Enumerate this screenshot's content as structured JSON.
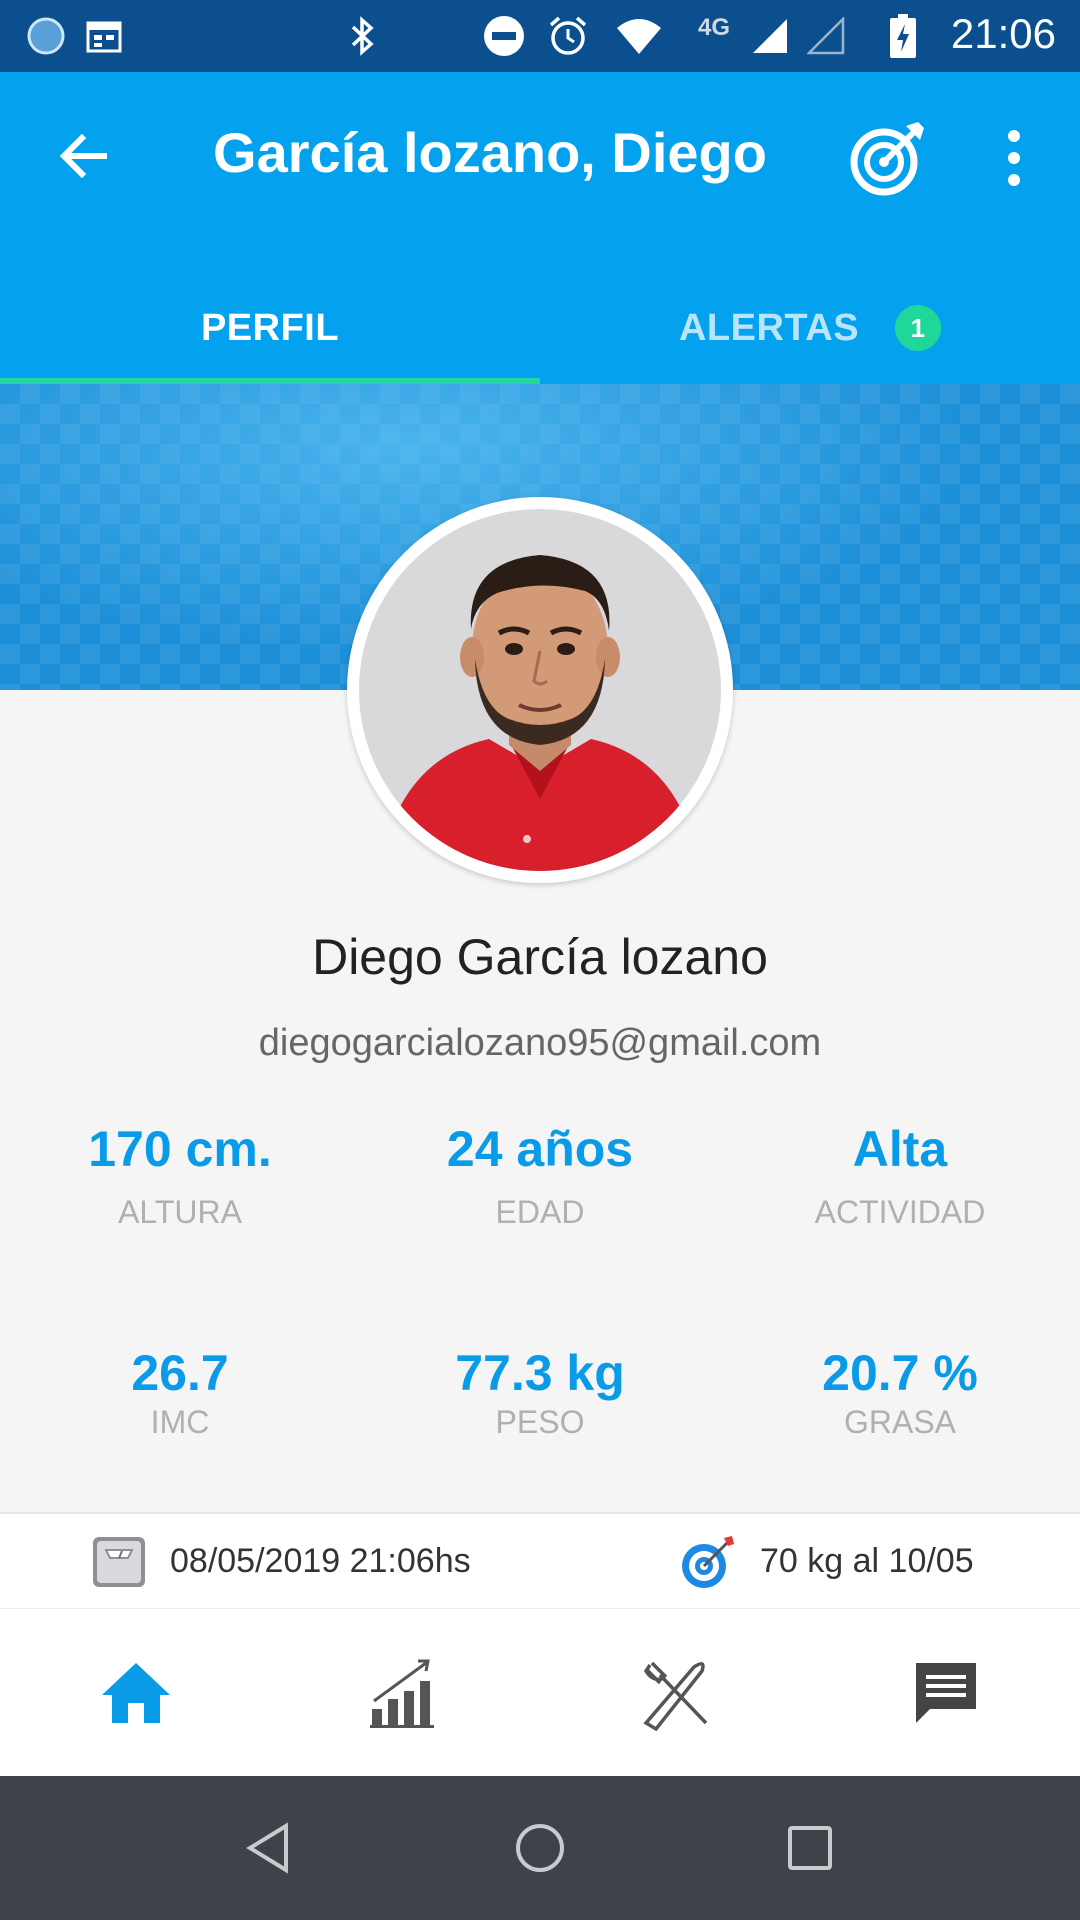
{
  "status_bar": {
    "time": "21:06",
    "network": "4G",
    "icons": [
      "app-circle-icon",
      "calendar-icon",
      "bluetooth-icon",
      "do-not-disturb-icon",
      "alarm-icon",
      "wifi-icon",
      "signal-icon",
      "signal-empty-icon",
      "battery-charging-icon"
    ]
  },
  "header": {
    "title": "García lozano, Diego",
    "back_icon": "arrow-left-icon",
    "goal_icon": "target-arrow-icon",
    "more_icon": "more-vert-icon"
  },
  "tabs": [
    {
      "label": "PERFIL",
      "active": true
    },
    {
      "label": "ALERTAS",
      "active": false,
      "badge": "1"
    }
  ],
  "profile": {
    "name": "Diego García lozano",
    "email": "diegogarcialozano95@gmail.com"
  },
  "stats": [
    {
      "value": "170 cm.",
      "label": "ALTURA"
    },
    {
      "value": "24 años",
      "label": "EDAD"
    },
    {
      "value": "Alta",
      "label": "ACTIVIDAD"
    },
    {
      "value": "26.7",
      "label": "IMC"
    },
    {
      "value": "77.3 kg",
      "label": "PESO"
    },
    {
      "value": "20.7 %",
      "label": "GRASA"
    }
  ],
  "info": {
    "last_weigh": "08/05/2019 21:06hs",
    "goal": "70 kg al 10/05"
  },
  "bottom_nav": [
    "home-icon",
    "progress-chart-icon",
    "fork-knife-icon",
    "chat-icon"
  ],
  "colors": {
    "status_bar": "#0b4f8f",
    "app_bar": "#04a1ee",
    "accent": "#0a9be8",
    "tab_indicator": "#27d5a0",
    "badge": "#20d79a",
    "system_nav": "#3e434a"
  }
}
